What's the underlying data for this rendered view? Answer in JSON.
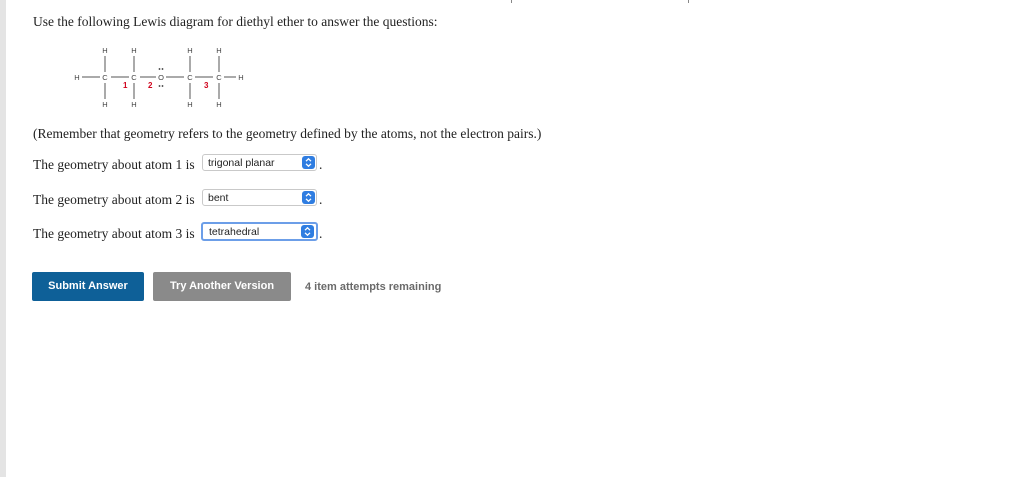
{
  "prompt": "Use the following Lewis diagram for diethyl ether to answer the questions:",
  "diagram": {
    "h_label": "H",
    "c_label": "C",
    "o_label": "O",
    "atom_number_1": "1",
    "atom_number_2": "2",
    "atom_number_3": "3",
    "number_color": "#d0021b"
  },
  "note": "(Remember that geometry refers to the geometry defined by the atoms, not the electron pairs.)",
  "questions": [
    {
      "label": "The geometry about atom 1 is",
      "value": "trigonal planar"
    },
    {
      "label": "The geometry about atom 2 is",
      "value": "bent"
    },
    {
      "label": "The geometry about atom 3 is",
      "value": "tetrahedral"
    }
  ],
  "sentence_end": ".",
  "buttons": {
    "submit_label": "Submit Answer",
    "try_label": "Try Another Version"
  },
  "attempts_text": "4 item attempts remaining",
  "colors": {
    "submit_bg": "#0e6098",
    "try_bg": "#8a8a8a",
    "select_arrow": "#2f7de1"
  }
}
